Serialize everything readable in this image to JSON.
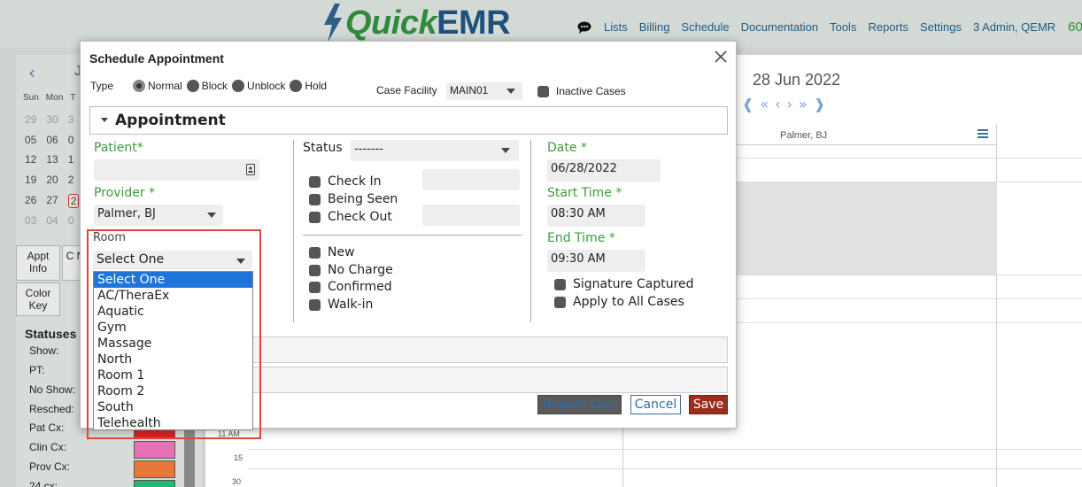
{
  "app": {
    "logo_quick": "Quick",
    "logo_emr": "EMR",
    "nav": [
      "Lists",
      "Billing",
      "Schedule",
      "Documentation",
      "Tools",
      "Reports",
      "Settings",
      "3 Admin, QEMR"
    ],
    "notification_count": "60",
    "colors": {
      "brand_green": "#2f8a3c",
      "brand_blue": "#1f4f7c",
      "save": "#9b2d1f",
      "highlight": "#1e74d8",
      "callout": "#e0473a"
    }
  },
  "left_panel": {
    "month_initial": "J",
    "days_of_week": [
      "Sun",
      "Mon",
      "T"
    ],
    "weeks": [
      [
        "29",
        "30",
        "3"
      ],
      [
        "05",
        "06",
        "0"
      ],
      [
        "12",
        "13",
        "1"
      ],
      [
        "19",
        "20",
        "2"
      ],
      [
        "26",
        "27",
        "2"
      ],
      [
        "03",
        "04",
        "0"
      ]
    ],
    "tabs": {
      "appt_info": "Appt Info",
      "clin_notes": "C N",
      "color_key": "Color Key"
    },
    "statuses_title": "Statuses",
    "statuses": [
      {
        "label": "Show:",
        "color": ""
      },
      {
        "label": "PT:",
        "color": ""
      },
      {
        "label": "No Show:",
        "color": ""
      },
      {
        "label": "Resched:",
        "color": ""
      },
      {
        "label": "Pat Cx:",
        "color": "#e02020"
      },
      {
        "label": "Clin Cx:",
        "color": "#e76fb3"
      },
      {
        "label": "Prov Cx:",
        "color": "#e9773a"
      },
      {
        "label": "24 cx:",
        "color": "#22b573"
      }
    ]
  },
  "calendar": {
    "date": "28 Jun 2022",
    "provider_column": "Palmer, BJ",
    "time_labels": [
      "11 AM",
      "15",
      "30"
    ]
  },
  "modal": {
    "title": "Schedule Appointment",
    "type_label": "Type",
    "type_options": [
      "Normal",
      "Block",
      "Unblock",
      "Hold"
    ],
    "type_selected": "Normal",
    "case_facility_label": "Case Facility",
    "case_facility_value": "MAIN01",
    "inactive_cases_label": "Inactive Cases",
    "section_title": "Appointment",
    "patient_label": "Patient*",
    "patient_value": "",
    "provider_label": "Provider *",
    "provider_value": "Palmer, BJ",
    "room_label": "Room",
    "room_value": "Select One",
    "room_options": [
      "Select One",
      "AC/TheraEx",
      "Aquatic",
      "Gym",
      "Massage",
      "North",
      "Room 1",
      "Room 2",
      "South",
      "Telehealth"
    ],
    "room_highlighted": 0,
    "status_label": "Status",
    "status_value": "-------",
    "status_checks": [
      "Check In",
      "Being Seen",
      "Check Out"
    ],
    "flag_checks": [
      "New",
      "No Charge",
      "Confirmed",
      "Walk-in"
    ],
    "date_label": "Date *",
    "date_value": "06/28/2022",
    "start_label": "Start Time *",
    "start_value": "08:30 AM",
    "end_label": "End Time *",
    "end_value": "09:30 AM",
    "extra_checks": [
      "Signature Captured",
      "Apply to All Cases"
    ],
    "buttons": {
      "repeat_last": "Repeat Last",
      "cancel": "Cancel",
      "save": "Save"
    }
  }
}
